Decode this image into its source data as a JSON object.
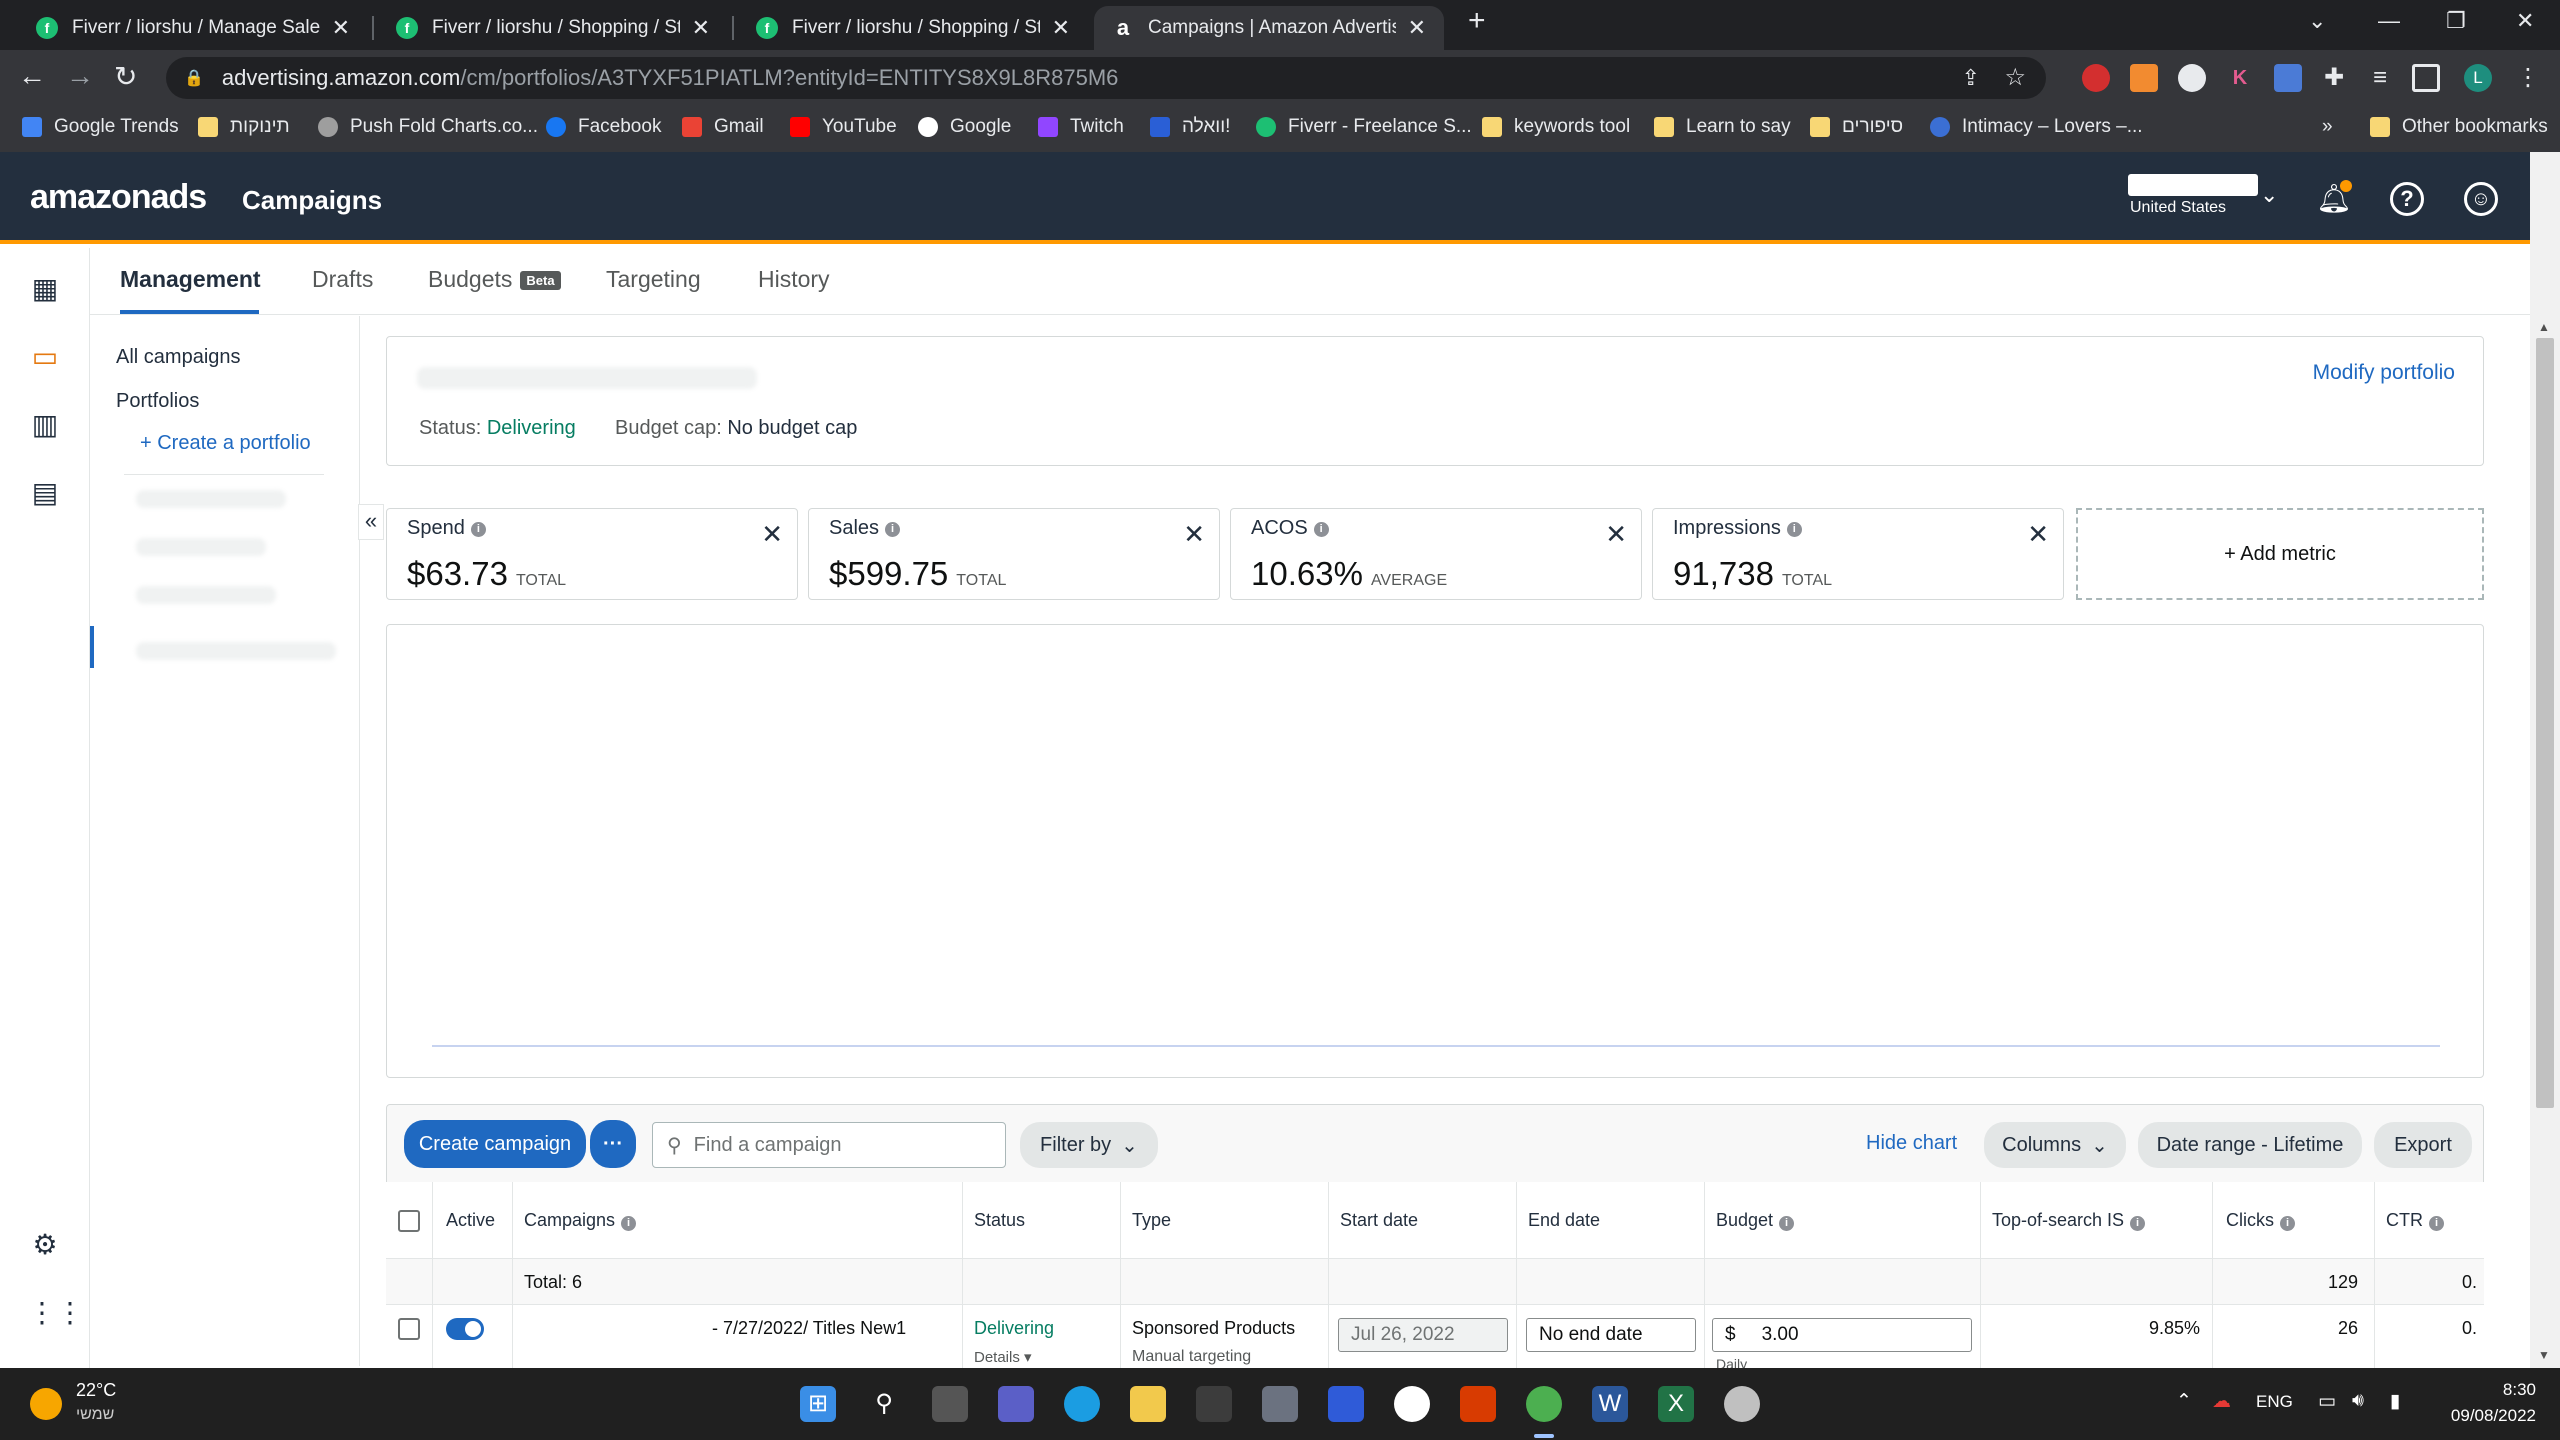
{
  "browser": {
    "tabs": [
      {
        "title": "Fiverr / liorshu / Manage Sales",
        "favicon": "fiverr-icon"
      },
      {
        "title": "Fiverr / liorshu / Shopping / Statu",
        "favicon": "fiverr-icon"
      },
      {
        "title": "Fiverr / liorshu / Shopping / Statu",
        "favicon": "fiverr-icon"
      },
      {
        "title": "Campaigns | Amazon Advertising",
        "favicon": "amazon-icon",
        "active": true
      }
    ],
    "url_host": "advertising.amazon.com",
    "url_path": "/cm/portfolios/A3TYXF51PIATLM?entityId=ENTITYS8X9L8R875M6",
    "bookmarks": [
      "Google Trends",
      "תינוקות",
      "Push Fold Charts.co...",
      "Facebook",
      "Gmail",
      "YouTube",
      "Google",
      "Twitch",
      "וואלה!",
      "Fiverr - Freelance S...",
      "keywords tool",
      "Learn to say",
      "סיפורים",
      "Intimacy – Lovers –..."
    ],
    "other_bookmarks": "Other bookmarks",
    "more_bookmarks": "»",
    "profile_initial": "L"
  },
  "header": {
    "logo": "amazonads",
    "app_title": "Campaigns",
    "country": "United States"
  },
  "nav": {
    "tabs": [
      "Management",
      "Drafts",
      "Budgets",
      "Targeting",
      "History"
    ],
    "beta_badge": "Beta"
  },
  "left_panel": {
    "all_campaigns": "All campaigns",
    "portfolios": "Portfolios",
    "create_portfolio": "+ Create a portfolio"
  },
  "portfolio": {
    "status_label": "Status:",
    "status_value": "Delivering",
    "budget_label": "Budget cap:",
    "budget_value": "No budget cap",
    "modify": "Modify portfolio"
  },
  "metrics": [
    {
      "name": "Spend",
      "value": "$63.73",
      "sub": "TOTAL"
    },
    {
      "name": "Sales",
      "value": "$599.75",
      "sub": "TOTAL"
    },
    {
      "name": "ACOS",
      "value": "10.63%",
      "sub": "AVERAGE"
    },
    {
      "name": "Impressions",
      "value": "91,738",
      "sub": "TOTAL"
    }
  ],
  "add_metric": "+ Add metric",
  "toolbar": {
    "create_campaign": "Create campaign",
    "more": "···",
    "search_placeholder": "Find a campaign",
    "filter_by": "Filter by",
    "hide_chart": "Hide chart",
    "columns": "Columns",
    "date_range": "Date range - Lifetime",
    "export": "Export"
  },
  "table": {
    "headers": [
      "Active",
      "Campaigns",
      "Status",
      "Type",
      "Start date",
      "End date",
      "Budget",
      "Top-of-search IS",
      "Clicks",
      "CTR"
    ],
    "total_label": "Total: 6",
    "total_clicks": "129",
    "total_ctr": "0.",
    "rows": [
      {
        "campaign": "- 7/27/2022/ Titles New1",
        "status": "Delivering",
        "details": "Details",
        "type": "Sponsored Products",
        "targeting": "Manual targeting",
        "start_date": "Jul 26, 2022",
        "end_date": "No end date",
        "budget_currency": "$",
        "budget": "3.00",
        "budget_period": "Daily",
        "top_of_search": "9.85%",
        "clicks": "26",
        "ctr": "0."
      }
    ]
  },
  "taskbar": {
    "temp": "22°C",
    "weather": "שמשי",
    "lang": "ENG",
    "time": "8:30",
    "date": "09/08/2022"
  },
  "colors": {
    "header_bg": "#232f3e",
    "accent": "#ff9900",
    "link": "#1f69c1",
    "delivering": "#067d62"
  }
}
